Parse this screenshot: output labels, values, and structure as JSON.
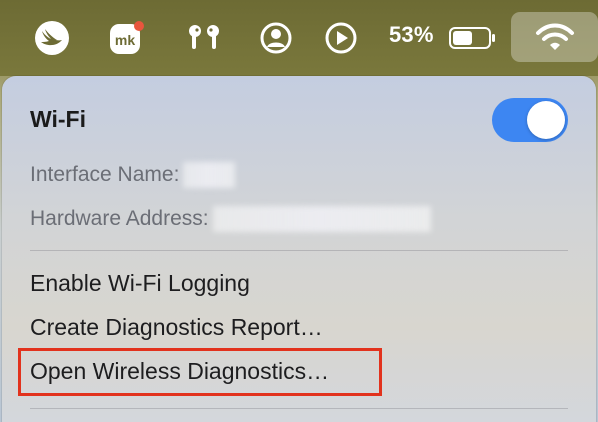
{
  "menubar": {
    "icons": [
      "swift-bird-icon",
      "mk-app-icon",
      "airpods-icon",
      "user-account-icon",
      "play-circle-icon",
      "battery-icon",
      "wifi-icon"
    ],
    "battery_percent": "53%",
    "badge_color": "#e8553d"
  },
  "wifi_menu": {
    "title": "Wi-Fi",
    "toggle_on": true,
    "accent_color": "#3d86f2",
    "interface_name_label": "Interface Name:",
    "hardware_address_label": "Hardware Address:",
    "items": [
      "Enable Wi-Fi Logging",
      "Create Diagnostics Report…",
      "Open Wireless Diagnostics…"
    ],
    "highlight_color": "#e2321d"
  }
}
